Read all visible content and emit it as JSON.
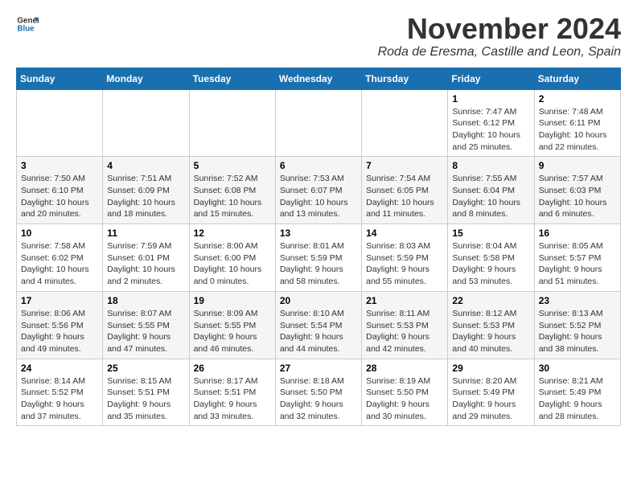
{
  "header": {
    "logo_line1": "General",
    "logo_line2": "Blue",
    "month": "November 2024",
    "location": "Roda de Eresma, Castille and Leon, Spain"
  },
  "days_of_week": [
    "Sunday",
    "Monday",
    "Tuesday",
    "Wednesday",
    "Thursday",
    "Friday",
    "Saturday"
  ],
  "weeks": [
    [
      {
        "day": "",
        "info": ""
      },
      {
        "day": "",
        "info": ""
      },
      {
        "day": "",
        "info": ""
      },
      {
        "day": "",
        "info": ""
      },
      {
        "day": "",
        "info": ""
      },
      {
        "day": "1",
        "info": "Sunrise: 7:47 AM\nSunset: 6:12 PM\nDaylight: 10 hours and 25 minutes."
      },
      {
        "day": "2",
        "info": "Sunrise: 7:48 AM\nSunset: 6:11 PM\nDaylight: 10 hours and 22 minutes."
      }
    ],
    [
      {
        "day": "3",
        "info": "Sunrise: 7:50 AM\nSunset: 6:10 PM\nDaylight: 10 hours and 20 minutes."
      },
      {
        "day": "4",
        "info": "Sunrise: 7:51 AM\nSunset: 6:09 PM\nDaylight: 10 hours and 18 minutes."
      },
      {
        "day": "5",
        "info": "Sunrise: 7:52 AM\nSunset: 6:08 PM\nDaylight: 10 hours and 15 minutes."
      },
      {
        "day": "6",
        "info": "Sunrise: 7:53 AM\nSunset: 6:07 PM\nDaylight: 10 hours and 13 minutes."
      },
      {
        "day": "7",
        "info": "Sunrise: 7:54 AM\nSunset: 6:05 PM\nDaylight: 10 hours and 11 minutes."
      },
      {
        "day": "8",
        "info": "Sunrise: 7:55 AM\nSunset: 6:04 PM\nDaylight: 10 hours and 8 minutes."
      },
      {
        "day": "9",
        "info": "Sunrise: 7:57 AM\nSunset: 6:03 PM\nDaylight: 10 hours and 6 minutes."
      }
    ],
    [
      {
        "day": "10",
        "info": "Sunrise: 7:58 AM\nSunset: 6:02 PM\nDaylight: 10 hours and 4 minutes."
      },
      {
        "day": "11",
        "info": "Sunrise: 7:59 AM\nSunset: 6:01 PM\nDaylight: 10 hours and 2 minutes."
      },
      {
        "day": "12",
        "info": "Sunrise: 8:00 AM\nSunset: 6:00 PM\nDaylight: 10 hours and 0 minutes."
      },
      {
        "day": "13",
        "info": "Sunrise: 8:01 AM\nSunset: 5:59 PM\nDaylight: 9 hours and 58 minutes."
      },
      {
        "day": "14",
        "info": "Sunrise: 8:03 AM\nSunset: 5:59 PM\nDaylight: 9 hours and 55 minutes."
      },
      {
        "day": "15",
        "info": "Sunrise: 8:04 AM\nSunset: 5:58 PM\nDaylight: 9 hours and 53 minutes."
      },
      {
        "day": "16",
        "info": "Sunrise: 8:05 AM\nSunset: 5:57 PM\nDaylight: 9 hours and 51 minutes."
      }
    ],
    [
      {
        "day": "17",
        "info": "Sunrise: 8:06 AM\nSunset: 5:56 PM\nDaylight: 9 hours and 49 minutes."
      },
      {
        "day": "18",
        "info": "Sunrise: 8:07 AM\nSunset: 5:55 PM\nDaylight: 9 hours and 47 minutes."
      },
      {
        "day": "19",
        "info": "Sunrise: 8:09 AM\nSunset: 5:55 PM\nDaylight: 9 hours and 46 minutes."
      },
      {
        "day": "20",
        "info": "Sunrise: 8:10 AM\nSunset: 5:54 PM\nDaylight: 9 hours and 44 minutes."
      },
      {
        "day": "21",
        "info": "Sunrise: 8:11 AM\nSunset: 5:53 PM\nDaylight: 9 hours and 42 minutes."
      },
      {
        "day": "22",
        "info": "Sunrise: 8:12 AM\nSunset: 5:53 PM\nDaylight: 9 hours and 40 minutes."
      },
      {
        "day": "23",
        "info": "Sunrise: 8:13 AM\nSunset: 5:52 PM\nDaylight: 9 hours and 38 minutes."
      }
    ],
    [
      {
        "day": "24",
        "info": "Sunrise: 8:14 AM\nSunset: 5:52 PM\nDaylight: 9 hours and 37 minutes."
      },
      {
        "day": "25",
        "info": "Sunrise: 8:15 AM\nSunset: 5:51 PM\nDaylight: 9 hours and 35 minutes."
      },
      {
        "day": "26",
        "info": "Sunrise: 8:17 AM\nSunset: 5:51 PM\nDaylight: 9 hours and 33 minutes."
      },
      {
        "day": "27",
        "info": "Sunrise: 8:18 AM\nSunset: 5:50 PM\nDaylight: 9 hours and 32 minutes."
      },
      {
        "day": "28",
        "info": "Sunrise: 8:19 AM\nSunset: 5:50 PM\nDaylight: 9 hours and 30 minutes."
      },
      {
        "day": "29",
        "info": "Sunrise: 8:20 AM\nSunset: 5:49 PM\nDaylight: 9 hours and 29 minutes."
      },
      {
        "day": "30",
        "info": "Sunrise: 8:21 AM\nSunset: 5:49 PM\nDaylight: 9 hours and 28 minutes."
      }
    ]
  ]
}
